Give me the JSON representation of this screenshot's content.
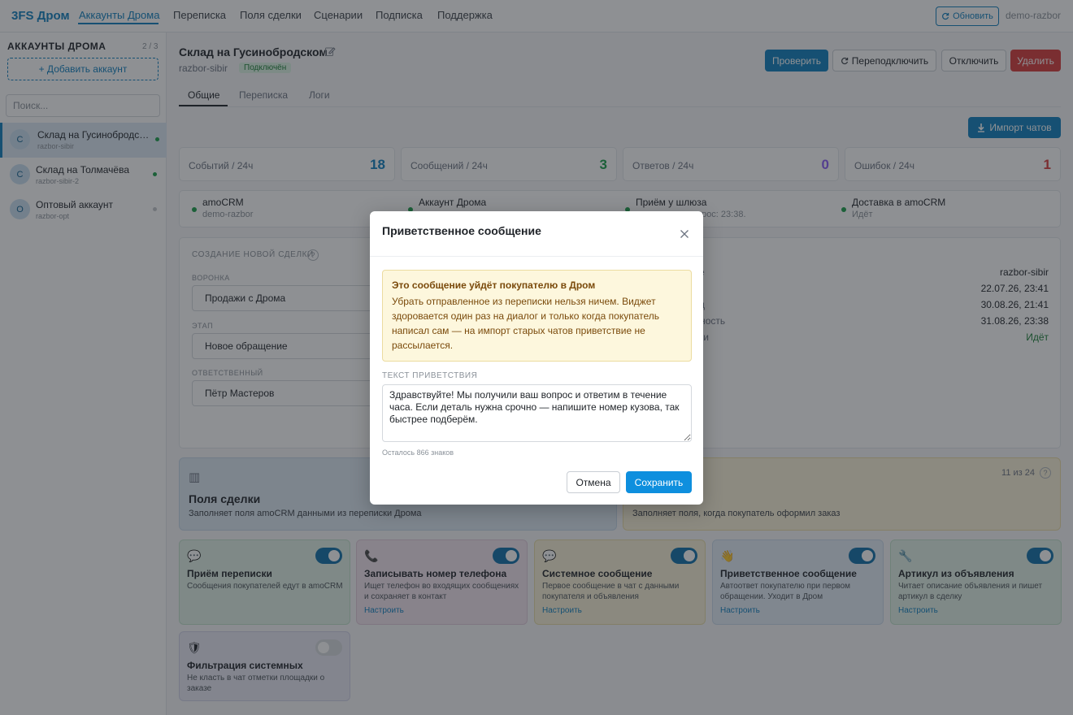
{
  "topnav": {
    "brand": "3FS Дром",
    "items": [
      "Аккаунты Дрома",
      "Переписка",
      "Поля сделки",
      "Сценарии",
      "Подписка",
      "Поддержка"
    ],
    "refresh_label": "Обновить",
    "user": "demo-razbor"
  },
  "sidebar": {
    "title": "АККАУНТЫ ДРОМА",
    "count": "2 / 3",
    "add_label": "+ Добавить аккаунт",
    "search_placeholder": "Поиск...",
    "accounts": [
      {
        "avatar": "С",
        "name": "Склад на Гусинобродском",
        "login": "razbor-sibir",
        "status_color": "#1a9f4a"
      },
      {
        "avatar": "С",
        "name": "Склад на Толмачёва",
        "login": "razbor-sibir-2",
        "status_color": "#1a9f4a"
      },
      {
        "avatar": "О",
        "name": "Оптовый аккаунт",
        "login": "razbor-opt",
        "status_color": "#c2c6cb"
      }
    ]
  },
  "header": {
    "title": "Склад на Гусинобродском",
    "login": "razbor-sibir",
    "status": "Подключён",
    "buttons": {
      "check": "Проверить",
      "reconnect": "Переподключить",
      "disconnect": "Отключить",
      "delete": "Удалить"
    }
  },
  "tabs": [
    "Общие",
    "Переписка",
    "Логи"
  ],
  "import_label": "Импорт чатов",
  "stats": [
    {
      "label": "Событий / 24ч",
      "value": "18",
      "color": "#0e7fbf"
    },
    {
      "label": "Сообщений / 24ч",
      "value": "3",
      "color": "#1a9f4a"
    },
    {
      "label": "Ответов / 24ч",
      "value": "0",
      "color": "#8b5cf6"
    },
    {
      "label": "Ошибок / 24ч",
      "value": "1",
      "color": "#d73a3a"
    }
  ],
  "status_items": [
    {
      "title": "amoCRM",
      "sub": "demo-razbor"
    },
    {
      "title": "Аккаунт Дрома",
      "sub": ""
    },
    {
      "title": "Приём у шлюза",
      "sub": "опрос: 23:38."
    },
    {
      "title": "Доставка в amoCRM",
      "sub": "Идёт"
    }
  ],
  "deal": {
    "section_title": "СОЗДАНИЕ НОВОЙ СДЕЛКИ",
    "help": "?",
    "fields": [
      {
        "label": "ВОРОНКА",
        "value": "Продажи с Дрома"
      },
      {
        "label": "ЭТАП",
        "value": "Новое обращение"
      },
      {
        "label": "ОТВЕТСТВЕННЫЙ",
        "value": "Пётр Мастеров"
      }
    ],
    "info": [
      {
        "label": "е",
        "value": "razbor-sibir"
      },
      {
        "label": "",
        "value": "22.07.26, 23:41"
      },
      {
        "label": "д",
        "value": "30.08.26, 21:41"
      },
      {
        "label": "ивность",
        "value": "31.08.26, 23:38"
      },
      {
        "label": "ски",
        "value": "Идёт"
      }
    ]
  },
  "big_cards": [
    {
      "icon": "▥",
      "title": "Поля сделки",
      "desc": "Заполняет поля amoCRM данными из переписки Дрома"
    },
    {
      "count": "11 из 24",
      "desc": "Заполняет поля, когда покупатель оформил заказ"
    }
  ],
  "features": [
    {
      "icon": "💬",
      "title": "Приём переписки",
      "desc": "Сообщения покупателей едут в amoCRM",
      "link": "",
      "on": true
    },
    {
      "icon": "📞",
      "title": "Записывать номер телефона",
      "desc": "Ищет телефон во входящих сообщениях и сохраняет в контакт",
      "link": "Настроить",
      "on": true
    },
    {
      "icon": "💬",
      "title": "Системное сообщение",
      "desc": "Первое сообщение в чат с данными покупателя и объявления",
      "link": "Настроить",
      "on": true
    },
    {
      "icon": "👋",
      "title": "Приветственное сообщение",
      "desc": "Автоответ покупателю при первом обращении. Уходит в Дром",
      "link": "Настроить",
      "on": true
    },
    {
      "icon": "🔧",
      "title": "Артикул из объявления",
      "desc": "Читает описание объявления и пишет артикул в сделку",
      "link": "Настроить",
      "on": true
    },
    {
      "icon": "🛡",
      "title": "Фильтрация системных",
      "desc": "Не класть в чат отметки площадки о заказе",
      "link": "",
      "on": false
    }
  ],
  "modal": {
    "title": "Приветственное сообщение",
    "warning_title": "Это сообщение уйдёт покупателю в Дром",
    "warning_text": "Убрать отправленное из переписки нельзя ничем. Виджет здоровается один раз на диалог и только когда покупатель написал сам — на импорт старых чатов приветствие не рассылается.",
    "field_label": "ТЕКСТ ПРИВЕТСТВИЯ",
    "text": "Здравствуйте! Мы получили ваш вопрос и ответим в течение часа. Если деталь нужна срочно — напишите номер кузова, так быстрее подберём.",
    "remaining": "Осталось 866 знаков",
    "cancel": "Отмена",
    "save": "Сохранить"
  }
}
